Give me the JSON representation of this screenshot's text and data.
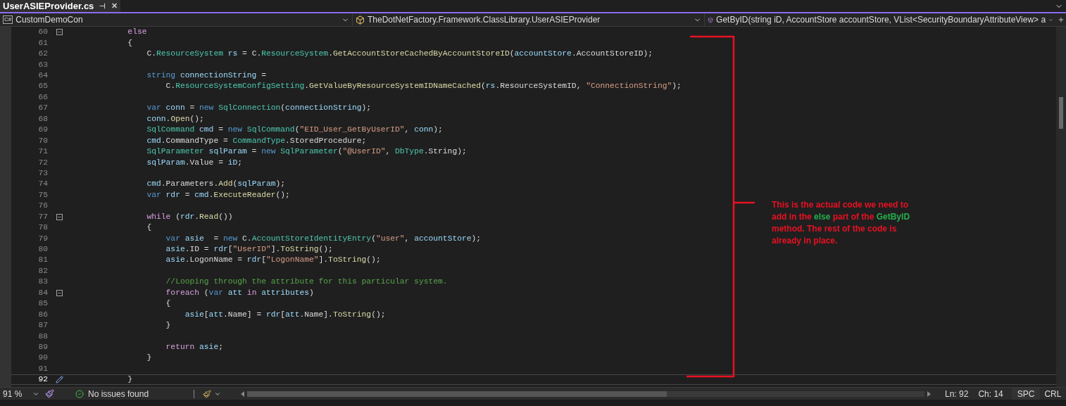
{
  "tab": {
    "title": "UserASIEProvider.cs",
    "pin": "⊣",
    "close": "✕"
  },
  "navbar": {
    "project_icon": "C#",
    "project": "CustomDemoCon",
    "class": "TheDotNetFactory.Framework.ClassLibrary.UserASIEProvider",
    "member": "GetByID(string iD, AccountStore accountStore, VList<SecurityBoundaryAttributeView> a"
  },
  "lines": [
    {
      "number": "60",
      "current": false,
      "kind": "fold",
      "tokens": [
        {
          "text": "            else",
          "kind": "control"
        }
      ]
    },
    {
      "number": "61",
      "current": false,
      "tokens": [
        {
          "text": "            {",
          "kind": "plain"
        }
      ]
    },
    {
      "number": "62",
      "current": false,
      "tokens": [
        {
          "text": "                C.",
          "kind": "plain"
        },
        {
          "text": "ResourceSystem",
          "kind": "type"
        },
        {
          "text": " rs",
          "kind": "variable"
        },
        {
          "text": " = C.",
          "kind": "plain"
        },
        {
          "text": "ResourceSystem",
          "kind": "type"
        },
        {
          "text": ".",
          "kind": "plain"
        },
        {
          "text": "GetAccountStoreCachedByAccountStoreID",
          "kind": "method"
        },
        {
          "text": "(",
          "kind": "plain"
        },
        {
          "text": "accountStore",
          "kind": "variable"
        },
        {
          "text": ".AccountStoreID);",
          "kind": "plain"
        }
      ]
    },
    {
      "number": "63",
      "current": false
    },
    {
      "number": "64",
      "current": false,
      "tokens": [
        {
          "text": "                string",
          "kind": "keyword"
        },
        {
          "text": " connectionString",
          "kind": "variable"
        },
        {
          "text": " =",
          "kind": "plain"
        }
      ]
    },
    {
      "number": "65",
      "current": false,
      "tokens": [
        {
          "text": "                    C.",
          "kind": "plain"
        },
        {
          "text": "ResourceSystemConfigSetting",
          "kind": "type"
        },
        {
          "text": ".",
          "kind": "plain"
        },
        {
          "text": "GetValueByResourceSystemIDNameCached",
          "kind": "method"
        },
        {
          "text": "(",
          "kind": "plain"
        },
        {
          "text": "rs",
          "kind": "variable"
        },
        {
          "text": ".ResourceSystemID, ",
          "kind": "plain"
        },
        {
          "text": "\"ConnectionString\"",
          "kind": "string"
        },
        {
          "text": ");",
          "kind": "plain"
        }
      ]
    },
    {
      "number": "66",
      "current": false
    },
    {
      "number": "67",
      "current": false,
      "tokens": [
        {
          "text": "                var",
          "kind": "keyword"
        },
        {
          "text": " conn",
          "kind": "variable"
        },
        {
          "text": " = ",
          "kind": "plain"
        },
        {
          "text": "new",
          "kind": "keyword"
        },
        {
          "text": " SqlConnection",
          "kind": "type"
        },
        {
          "text": "(",
          "kind": "plain"
        },
        {
          "text": "connectionString",
          "kind": "variable"
        },
        {
          "text": ");",
          "kind": "plain"
        }
      ]
    },
    {
      "number": "68",
      "current": false,
      "tokens": [
        {
          "text": "                conn",
          "kind": "variable"
        },
        {
          "text": ".",
          "kind": "plain"
        },
        {
          "text": "Open",
          "kind": "method"
        },
        {
          "text": "();",
          "kind": "plain"
        }
      ]
    },
    {
      "number": "69",
      "current": false,
      "tokens": [
        {
          "text": "                SqlCommand",
          "kind": "type"
        },
        {
          "text": " cmd",
          "kind": "variable"
        },
        {
          "text": " = ",
          "kind": "plain"
        },
        {
          "text": "new",
          "kind": "keyword"
        },
        {
          "text": " SqlCommand",
          "kind": "type"
        },
        {
          "text": "(",
          "kind": "plain"
        },
        {
          "text": "\"EID_User_GetByUserID\"",
          "kind": "string"
        },
        {
          "text": ", ",
          "kind": "plain"
        },
        {
          "text": "conn",
          "kind": "variable"
        },
        {
          "text": ");",
          "kind": "plain"
        }
      ]
    },
    {
      "number": "70",
      "current": false,
      "tokens": [
        {
          "text": "                cmd",
          "kind": "variable"
        },
        {
          "text": ".CommandType = ",
          "kind": "plain"
        },
        {
          "text": "CommandType",
          "kind": "type"
        },
        {
          "text": ".StoredProcedure;",
          "kind": "plain"
        }
      ]
    },
    {
      "number": "71",
      "current": false,
      "tokens": [
        {
          "text": "                SqlParameter",
          "kind": "type"
        },
        {
          "text": " sqlParam",
          "kind": "variable"
        },
        {
          "text": " = ",
          "kind": "plain"
        },
        {
          "text": "new",
          "kind": "keyword"
        },
        {
          "text": " SqlParameter",
          "kind": "type"
        },
        {
          "text": "(",
          "kind": "plain"
        },
        {
          "text": "\"@UserID\"",
          "kind": "string"
        },
        {
          "text": ", ",
          "kind": "plain"
        },
        {
          "text": "DbType",
          "kind": "type"
        },
        {
          "text": ".String);",
          "kind": "plain"
        }
      ]
    },
    {
      "number": "72",
      "current": false,
      "tokens": [
        {
          "text": "                sqlParam",
          "kind": "variable"
        },
        {
          "text": ".Value = ",
          "kind": "plain"
        },
        {
          "text": "iD",
          "kind": "variable"
        },
        {
          "text": ";",
          "kind": "plain"
        }
      ]
    },
    {
      "number": "73",
      "current": false
    },
    {
      "number": "74",
      "current": false,
      "tokens": [
        {
          "text": "                cmd",
          "kind": "variable"
        },
        {
          "text": ".Parameters.",
          "kind": "plain"
        },
        {
          "text": "Add",
          "kind": "method"
        },
        {
          "text": "(",
          "kind": "plain"
        },
        {
          "text": "sqlParam",
          "kind": "variable"
        },
        {
          "text": ");",
          "kind": "plain"
        }
      ]
    },
    {
      "number": "75",
      "current": false,
      "tokens": [
        {
          "text": "                var",
          "kind": "keyword"
        },
        {
          "text": " rdr",
          "kind": "variable"
        },
        {
          "text": " = ",
          "kind": "plain"
        },
        {
          "text": "cmd",
          "kind": "variable"
        },
        {
          "text": ".",
          "kind": "plain"
        },
        {
          "text": "ExecuteReader",
          "kind": "method"
        },
        {
          "text": "();",
          "kind": "plain"
        }
      ]
    },
    {
      "number": "76",
      "current": false
    },
    {
      "number": "77",
      "current": false,
      "kind": "fold",
      "tokens": [
        {
          "text": "                while",
          "kind": "control"
        },
        {
          "text": " (",
          "kind": "plain"
        },
        {
          "text": "rdr",
          "kind": "variable"
        },
        {
          "text": ".",
          "kind": "plain"
        },
        {
          "text": "Read",
          "kind": "method"
        },
        {
          "text": "())",
          "kind": "plain"
        }
      ]
    },
    {
      "number": "78",
      "current": false,
      "tokens": [
        {
          "text": "                {",
          "kind": "plain"
        }
      ]
    },
    {
      "number": "79",
      "current": false,
      "tokens": [
        {
          "text": "                    var",
          "kind": "keyword"
        },
        {
          "text": " asie",
          "kind": "variable"
        },
        {
          "text": "  = ",
          "kind": "plain"
        },
        {
          "text": "new",
          "kind": "keyword"
        },
        {
          "text": " C.",
          "kind": "plain"
        },
        {
          "text": "AccountStoreIdentityEntry",
          "kind": "type"
        },
        {
          "text": "(",
          "kind": "plain"
        },
        {
          "text": "\"user\"",
          "kind": "string"
        },
        {
          "text": ", ",
          "kind": "plain"
        },
        {
          "text": "accountStore",
          "kind": "variable"
        },
        {
          "text": ");",
          "kind": "plain"
        }
      ]
    },
    {
      "number": "80",
      "current": false,
      "tokens": [
        {
          "text": "                    asie",
          "kind": "variable"
        },
        {
          "text": ".ID = ",
          "kind": "plain"
        },
        {
          "text": "rdr",
          "kind": "variable"
        },
        {
          "text": "[",
          "kind": "plain"
        },
        {
          "text": "\"UserID\"",
          "kind": "string"
        },
        {
          "text": "].",
          "kind": "plain"
        },
        {
          "text": "ToString",
          "kind": "method"
        },
        {
          "text": "();",
          "kind": "plain"
        }
      ]
    },
    {
      "number": "81",
      "current": false,
      "tokens": [
        {
          "text": "                    asie",
          "kind": "variable"
        },
        {
          "text": ".LogonName = ",
          "kind": "plain"
        },
        {
          "text": "rdr",
          "kind": "variable"
        },
        {
          "text": "[",
          "kind": "plain"
        },
        {
          "text": "\"LogonName\"",
          "kind": "string"
        },
        {
          "text": "].",
          "kind": "plain"
        },
        {
          "text": "ToString",
          "kind": "method"
        },
        {
          "text": "();",
          "kind": "plain"
        }
      ]
    },
    {
      "number": "82",
      "current": false
    },
    {
      "number": "83",
      "current": false,
      "tokens": [
        {
          "text": "                    //Looping through the attribute for this particular system.",
          "kind": "comment"
        }
      ]
    },
    {
      "number": "84",
      "current": false,
      "kind": "fold",
      "tokens": [
        {
          "text": "                    foreach",
          "kind": "control"
        },
        {
          "text": " (",
          "kind": "plain"
        },
        {
          "text": "var",
          "kind": "keyword"
        },
        {
          "text": " att ",
          "kind": "variable"
        },
        {
          "text": "in",
          "kind": "control"
        },
        {
          "text": " attributes",
          "kind": "variable"
        },
        {
          "text": ")",
          "kind": "plain"
        }
      ]
    },
    {
      "number": "85",
      "current": false,
      "tokens": [
        {
          "text": "                    {",
          "kind": "plain"
        }
      ]
    },
    {
      "number": "86",
      "current": false,
      "tokens": [
        {
          "text": "                        asie",
          "kind": "variable"
        },
        {
          "text": "[",
          "kind": "plain"
        },
        {
          "text": "att",
          "kind": "variable"
        },
        {
          "text": ".Name] = ",
          "kind": "plain"
        },
        {
          "text": "rdr",
          "kind": "variable"
        },
        {
          "text": "[",
          "kind": "plain"
        },
        {
          "text": "att",
          "kind": "variable"
        },
        {
          "text": ".Name].",
          "kind": "plain"
        },
        {
          "text": "ToString",
          "kind": "method"
        },
        {
          "text": "();",
          "kind": "plain"
        }
      ]
    },
    {
      "number": "87",
      "current": false,
      "tokens": [
        {
          "text": "                    }",
          "kind": "plain"
        }
      ]
    },
    {
      "number": "88",
      "current": false
    },
    {
      "number": "89",
      "current": false,
      "tokens": [
        {
          "text": "                    return",
          "kind": "control"
        },
        {
          "text": " asie",
          "kind": "variable"
        },
        {
          "text": ";",
          "kind": "plain"
        }
      ]
    },
    {
      "number": "90",
      "current": false,
      "tokens": [
        {
          "text": "                }",
          "kind": "plain"
        }
      ]
    },
    {
      "number": "91",
      "current": false
    },
    {
      "number": "92",
      "current": true,
      "kind": "edit",
      "tokens": [
        {
          "text": "            }",
          "kind": "plain"
        }
      ]
    }
  ],
  "annotation": {
    "segments": [
      {
        "text": "This is the actual code we need to add in the ",
        "kind": "normal"
      },
      {
        "text": "else",
        "kind": "highlight"
      },
      {
        "text": " part of the ",
        "kind": "normal"
      },
      {
        "text": "GetByID",
        "kind": "highlight"
      },
      {
        "text": " method. The rest of the code is already in place.",
        "kind": "normal"
      }
    ]
  },
  "status_bar": {
    "zoom": "91 %",
    "issues": "No issues found",
    "line": "Ln: 92",
    "column": "Ch: 14",
    "whitespace": "SPC",
    "line_ending": "CRL"
  }
}
